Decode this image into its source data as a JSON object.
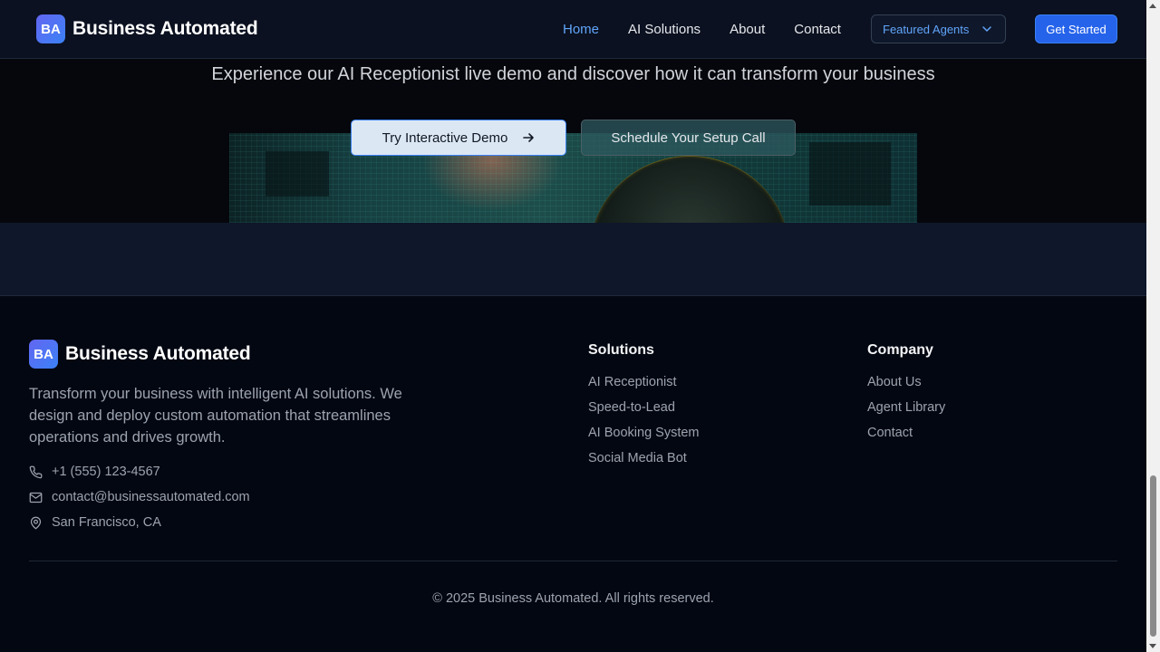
{
  "header": {
    "logo_badge": "BA",
    "logo_text": "Business Automated",
    "nav": [
      {
        "label": "Home",
        "active": true
      },
      {
        "label": "AI Solutions"
      },
      {
        "label": "About"
      },
      {
        "label": "Contact"
      }
    ],
    "featured_label": "Featured Agents",
    "cta_label": "Get Started"
  },
  "hero": {
    "subtitle": "Experience our AI Receptionist live demo and discover how it can transform your business",
    "primary_button": "Try Interactive Demo",
    "secondary_button": "Schedule Your Setup Call"
  },
  "footer": {
    "logo_badge": "BA",
    "logo_text": "Business Automated",
    "description": "Transform your business with intelligent AI solutions. We design and deploy custom automation that streamlines operations and drives growth.",
    "contact": {
      "phone": "+1 (555) 123-4567",
      "email": "contact@businessautomated.com",
      "location": "San Francisco, CA"
    },
    "solutions": {
      "title": "Solutions",
      "links": [
        "AI Receptionist",
        "Speed-to-Lead",
        "AI Booking System",
        "Social Media Bot"
      ]
    },
    "company": {
      "title": "Company",
      "links": [
        "About Us",
        "Agent Library",
        "Contact"
      ]
    },
    "copyright": "© 2025 Business Automated. All rights reserved."
  },
  "colors": {
    "accent": "#2563eb",
    "nav_active": "#60a5fa",
    "background": "#030712"
  }
}
